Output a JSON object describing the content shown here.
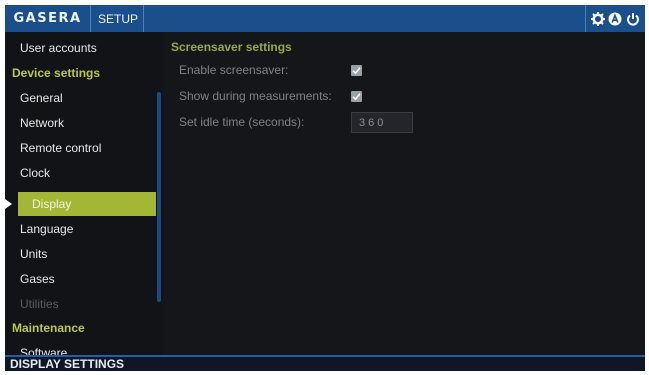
{
  "header": {
    "logo": "GASERA",
    "tab_label": "SETUP",
    "icons": [
      "gear-icon",
      "auto-a-icon",
      "power-icon"
    ]
  },
  "sidebar": {
    "items": [
      {
        "label": "User accounts",
        "kind": "item"
      },
      {
        "label": "Device settings",
        "kind": "section"
      },
      {
        "label": "General",
        "kind": "item"
      },
      {
        "label": "Network",
        "kind": "item"
      },
      {
        "label": "Remote control",
        "kind": "item"
      },
      {
        "label": "Clock",
        "kind": "item"
      },
      {
        "label": "Display",
        "kind": "selected"
      },
      {
        "label": "Language",
        "kind": "item"
      },
      {
        "label": "Units",
        "kind": "item"
      },
      {
        "label": "Gases",
        "kind": "item"
      },
      {
        "label": "Utilities",
        "kind": "disabled"
      },
      {
        "label": "Maintenance",
        "kind": "section"
      },
      {
        "label": "Software",
        "kind": "item"
      }
    ]
  },
  "main": {
    "title": "Screensaver settings",
    "enable_label": "Enable screensaver:",
    "enable_checked": true,
    "show_label": "Show during measurements:",
    "show_checked": true,
    "idle_label": "Set idle time (seconds):",
    "idle_value": "360"
  },
  "status": {
    "text": "DISPLAY SETTINGS"
  },
  "colors": {
    "header_blue": "#1b4f8c",
    "accent_green": "#a3b635",
    "section_text": "#b8c94a"
  }
}
